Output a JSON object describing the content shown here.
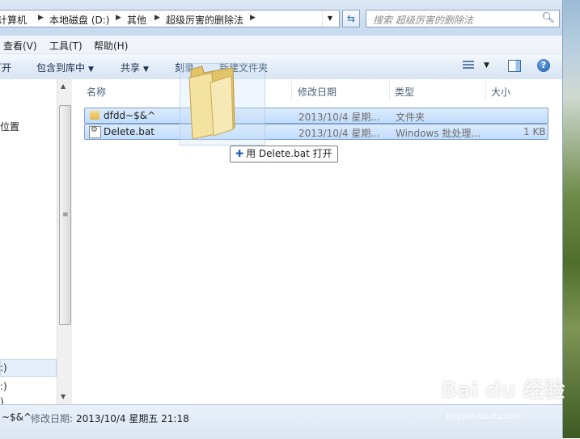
{
  "address": {
    "crumbs": [
      "计算机",
      "本地磁盘 (D:)",
      "其他",
      "超级厉害的删除法"
    ],
    "search_placeholder": "搜索 超级厉害的删除法"
  },
  "menubar": {
    "items": [
      "查看(V)",
      "工具(T)",
      "帮助(H)"
    ]
  },
  "toolbar": {
    "open_label": "打开",
    "include_library_label": "包含到库中",
    "share_label": "共享",
    "burn_label": "刻录",
    "new_folder_label": "新建文件夹"
  },
  "nav": {
    "items": [
      "位置",
      ":)",
      ":)",
      ")"
    ]
  },
  "columns": {
    "name": "名称",
    "modified": "修改日期",
    "type": "类型",
    "size": "大小"
  },
  "files": [
    {
      "name": "dfdd~$&^",
      "modified": "2013/10/4 星期...",
      "type": "文件夹",
      "size": ""
    },
    {
      "name": "Delete.bat",
      "modified": "2013/10/4 星期...",
      "type": "Windows 批处理...",
      "size": "1 KB"
    }
  ],
  "drag_tooltip": "用 Delete.bat 打开",
  "details": {
    "name": "~$&^",
    "label": "修改日期:",
    "value": "2013/10/4 星期五 21:18"
  },
  "watermark": {
    "main": "Bai du 经验",
    "sub": "jingyan.baidu.com"
  }
}
